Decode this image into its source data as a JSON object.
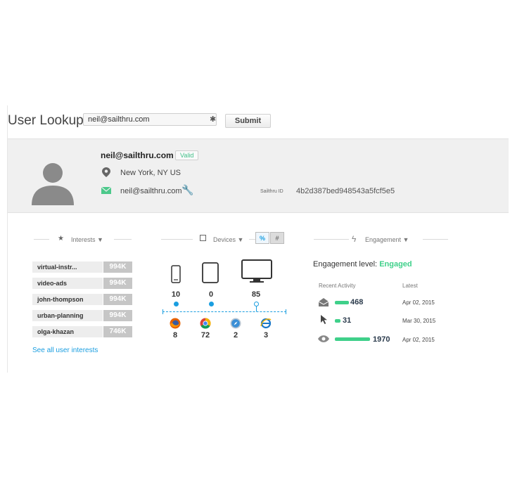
{
  "lookup": {
    "title": "User Lookup",
    "input_value": "neil@sailthru.com",
    "submit_label": "Submit"
  },
  "profile": {
    "email": "neil@sailthru.com",
    "status": "Valid",
    "location": "New York, NY US",
    "contact_email": "neil@sailthru.com",
    "sailthru_id_label": "Sailthru ID",
    "sailthru_id": "4b2d387bed948543a5fcf5e5"
  },
  "interests": {
    "heading": "Interests ▼",
    "items": [
      {
        "label": "virtual-instr...",
        "count": "994K"
      },
      {
        "label": "video-ads",
        "count": "994K"
      },
      {
        "label": "john-thompson",
        "count": "994K"
      },
      {
        "label": "urban-planning",
        "count": "994K"
      },
      {
        "label": "olga-khazan",
        "count": "746K"
      }
    ],
    "see_all": "See all user interests"
  },
  "devices": {
    "heading": "Devices ▼",
    "toggle_percent": "%",
    "toggle_count": "#",
    "items": [
      {
        "icon": "phone-icon",
        "value": "10"
      },
      {
        "icon": "tablet-icon",
        "value": "0"
      },
      {
        "icon": "desktop-icon",
        "value": "85"
      }
    ],
    "browsers": [
      {
        "icon": "firefox-icon",
        "value": "8"
      },
      {
        "icon": "chrome-icon",
        "value": "72"
      },
      {
        "icon": "safari-icon",
        "value": "2"
      },
      {
        "icon": "ie-icon",
        "value": "3"
      }
    ]
  },
  "engagement": {
    "heading": "Engagement ▼",
    "level_label": "Engagement level:",
    "level_value": "Engaged",
    "col_recent": "Recent Activity",
    "col_latest": "Latest",
    "rows": [
      {
        "icon": "envelope-open-icon",
        "value": "468",
        "fraction": 0.4,
        "date": "Apr 02, 2015"
      },
      {
        "icon": "cursor-icon",
        "value": "31",
        "fraction": 0.15,
        "date": "Mar 30, 2015"
      },
      {
        "icon": "eye-icon",
        "value": "1970",
        "fraction": 1.0,
        "date": "Apr 02, 2015"
      }
    ]
  },
  "colors": {
    "accent_green": "#3fd08a",
    "link_blue": "#1a9ee0",
    "device_blue": "#1a9ee0"
  }
}
